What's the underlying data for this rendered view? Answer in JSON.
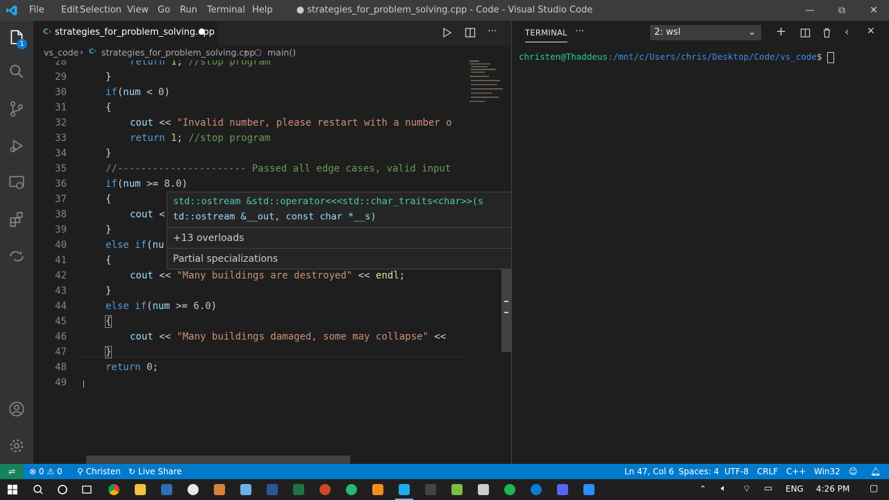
{
  "titlebar": {
    "menus": [
      "File",
      "Edit",
      "Selection",
      "View",
      "Go",
      "Run",
      "Terminal",
      "Help"
    ],
    "title": "● strategies_for_problem_solving.cpp - Code - Visual Studio Code"
  },
  "activity": {
    "badge": "1"
  },
  "editor": {
    "tab_label": "strategies_for_problem_solving.cpp",
    "breadcrumb": {
      "folder": "vs_code",
      "file": "strategies_for_problem_solving.cpp",
      "symbol": "main()"
    },
    "line_numbers": [
      "28",
      "29",
      "30",
      "31",
      "32",
      "33",
      "34",
      "35",
      "36",
      "37",
      "38",
      "39",
      "40",
      "41",
      "42",
      "43",
      "44",
      "45",
      "46",
      "47",
      "48",
      "49"
    ],
    "hover": {
      "sig1": "std::ostream &std::operator<<<std::char_traits<char>>(s",
      "sig2": "td::ostream &__out, const char *__s)",
      "overloads": "+13 overloads",
      "specializations": "Partial specializations"
    }
  },
  "terminal": {
    "tab_label": "TERMINAL",
    "selector": "2: wsl",
    "prompt_user": "christen@Thaddeus",
    "prompt_path": ":/mnt/c/Users/chris/Desktop/Code/vs_code",
    "prompt_symbol": "$"
  },
  "status": {
    "errors": "0",
    "warnings": "0",
    "user": "Christen",
    "live_share": "Live Share",
    "position": "Ln 47, Col 6",
    "spaces": "Spaces: 4",
    "encoding": "UTF-8",
    "eol": "CRLF",
    "language": "C++",
    "platform": "Win32"
  },
  "taskbar": {
    "language": "ENG",
    "time": "4:26 PM"
  },
  "colors": {
    "statusbar": "#007acc",
    "activitybar": "#333333",
    "editor_bg": "#1e1e1e",
    "accent_blue": "#0e7ad3"
  }
}
